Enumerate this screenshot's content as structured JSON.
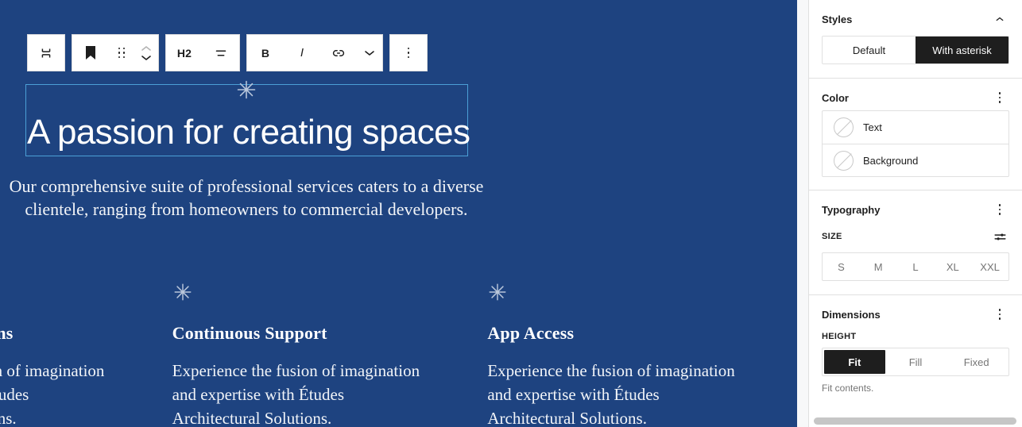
{
  "editor": {
    "background_color": "#1e4380",
    "toolbar": {
      "groups": [
        {
          "buttons": [
            {
              "name": "block-type-group-icon",
              "label": ""
            }
          ]
        },
        {
          "buttons": [
            {
              "name": "block-type-heading-icon",
              "label": ""
            },
            {
              "name": "drag-handle-icon",
              "label": ""
            },
            {
              "name": "move-up-down-icon",
              "label": ""
            }
          ]
        },
        {
          "buttons": [
            {
              "name": "heading-level-button",
              "label": "H2"
            },
            {
              "name": "align-text-button",
              "label": ""
            }
          ]
        },
        {
          "buttons": [
            {
              "name": "bold-button",
              "label": "B"
            },
            {
              "name": "italic-button",
              "label": "I"
            },
            {
              "name": "link-button",
              "label": ""
            },
            {
              "name": "more-rich-text-button",
              "label": ""
            }
          ]
        },
        {
          "buttons": [
            {
              "name": "block-options-button",
              "label": ""
            }
          ]
        }
      ]
    },
    "hero": {
      "heading": "A passion for creating spaces",
      "paragraph": "Our comprehensive suite of professional services caters to a diverse clientele, ranging from homeowners to commercial developers."
    },
    "features": [
      {
        "title": "Innovative Solutions",
        "body": "Experience the fusion of imagination and expertise with Études Architectural Solutions."
      },
      {
        "title": "Continuous Support",
        "body": "Experience the fusion of imagination and expertise with Études Architectural Solutions."
      },
      {
        "title": "App Access",
        "body": "Experience the fusion of imagination and expertise with Études Architectural Solutions."
      }
    ]
  },
  "sidebar": {
    "styles": {
      "title": "Styles",
      "toggle_icon": "chevron-up-icon",
      "variations": [
        {
          "label": "Default",
          "active": false
        },
        {
          "label": "With asterisk",
          "active": true
        }
      ]
    },
    "color": {
      "title": "Color",
      "menu_icon": "ellipsis-vertical-icon",
      "rows": [
        {
          "label": "Text",
          "swatch": "unset"
        },
        {
          "label": "Background",
          "swatch": "unset"
        }
      ]
    },
    "typography": {
      "title": "Typography",
      "menu_icon": "ellipsis-vertical-icon",
      "size_label": "SIZE",
      "size_settings_icon": "sliders-icon",
      "sizes": [
        {
          "label": "S",
          "active": false
        },
        {
          "label": "M",
          "active": false
        },
        {
          "label": "L",
          "active": false
        },
        {
          "label": "XL",
          "active": false
        },
        {
          "label": "XXL",
          "active": false
        }
      ]
    },
    "dimensions": {
      "title": "Dimensions",
      "menu_icon": "ellipsis-vertical-icon",
      "height_label": "HEIGHT",
      "options": [
        {
          "label": "Fit",
          "active": true
        },
        {
          "label": "Fill",
          "active": false
        },
        {
          "label": "Fixed",
          "active": false
        }
      ],
      "help_text": "Fit contents."
    }
  },
  "colors": {
    "editor_bg": "#1e4380",
    "accent_dark": "#1e1e1e",
    "selection_outline": "#4b9fd6",
    "asterisk": "#b8c6db"
  }
}
